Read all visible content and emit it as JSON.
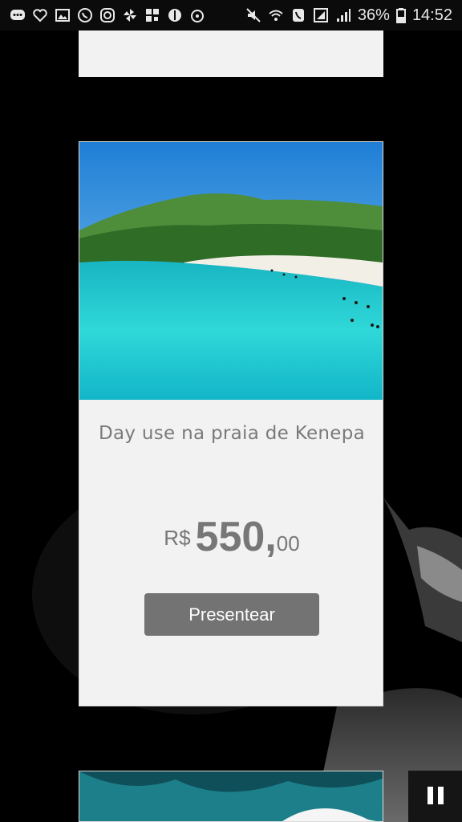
{
  "status_bar": {
    "battery_percent": "36%",
    "time": "14:52"
  },
  "product_card": {
    "title": "Day use na praia de Kenepa",
    "price": {
      "currency": "R$",
      "whole": "550,",
      "cents": "00"
    },
    "button_label": "Presentear"
  },
  "icons": {
    "pause": "pause-icon"
  }
}
